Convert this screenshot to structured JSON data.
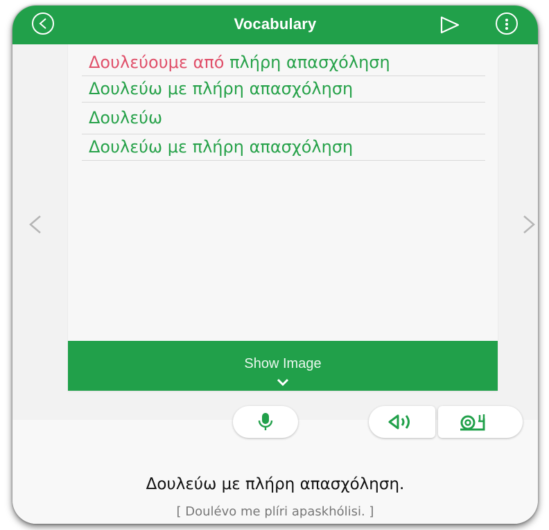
{
  "appbar": {
    "title": "Vocabulary",
    "back_icon": "back-circle-icon",
    "play_icon": "play-outline-icon",
    "more_icon": "more-vertical-icon"
  },
  "answers": [
    {
      "prefix": "Δουλεύουμε από",
      "rest": " πλήρη απασχόληση"
    },
    {
      "prefix": "",
      "rest": "Δουλεύω με πλήρη απασχόληση"
    },
    {
      "prefix": "",
      "rest": "Δουλεύω"
    },
    {
      "prefix": "",
      "rest": "Δουλεύω με πλήρη απασχόληση"
    }
  ],
  "show_image": {
    "label": "Show Image"
  },
  "sentence": "Δουλεύω με πλήρη απασχόληση.",
  "transliteration": "[ Doulévo me plíri apaskhólisi. ]",
  "colors": {
    "accent": "#21a04a",
    "wrong": "#e0506a"
  }
}
